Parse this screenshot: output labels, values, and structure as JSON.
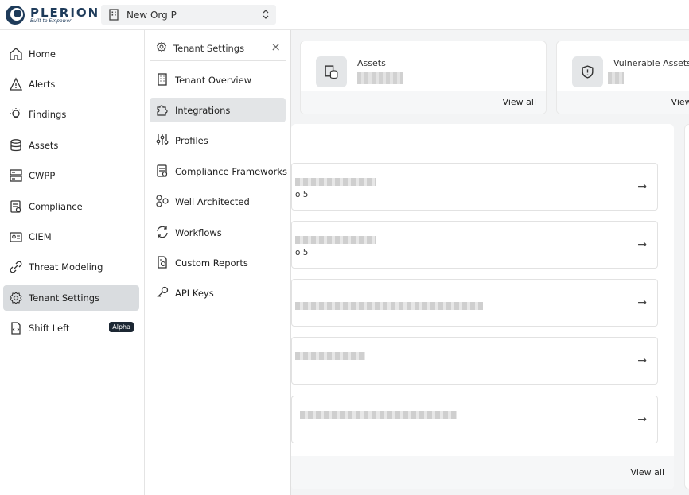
{
  "brand": {
    "name": "PLERION",
    "tagline": "Built to Empower"
  },
  "org_selector": {
    "value": "New Org P"
  },
  "nav": {
    "items": [
      {
        "label": "Home",
        "icon": "home-icon"
      },
      {
        "label": "Alerts",
        "icon": "alert-icon"
      },
      {
        "label": "Findings",
        "icon": "bulb-icon"
      },
      {
        "label": "Assets",
        "icon": "database-icon"
      },
      {
        "label": "CWPP",
        "icon": "server-icon"
      },
      {
        "label": "Compliance",
        "icon": "compliance-icon"
      },
      {
        "label": "CIEM",
        "icon": "id-card-icon"
      },
      {
        "label": "Threat Modeling",
        "icon": "link-icon"
      },
      {
        "label": "Tenant Settings",
        "icon": "gear-icon",
        "active": true
      },
      {
        "label": "Shift Left",
        "icon": "code-file-icon",
        "badge": "Alpha"
      }
    ]
  },
  "panel": {
    "title": "Tenant Settings",
    "items": [
      {
        "label": "Tenant Overview",
        "icon": "building-icon"
      },
      {
        "label": "Integrations",
        "icon": "puzzle-icon",
        "active": true
      },
      {
        "label": "Profiles",
        "icon": "sliders-icon"
      },
      {
        "label": "Compliance Frameworks",
        "icon": "compliance-icon"
      },
      {
        "label": "Well Architected",
        "icon": "hexagons-icon"
      },
      {
        "label": "Workflows",
        "icon": "refresh-icon"
      },
      {
        "label": "Custom Reports",
        "icon": "report-icon"
      },
      {
        "label": "API Keys",
        "icon": "key-icon"
      }
    ]
  },
  "stats": [
    {
      "title": "Assets",
      "footer": "View all"
    },
    {
      "title": "Vulnerable Assets",
      "footer": "View all"
    }
  ],
  "list": {
    "rows": [
      {
        "sub": "o 5"
      },
      {
        "sub": "o 5"
      },
      {
        "sub": ""
      },
      {
        "sub": ""
      },
      {
        "sub": ""
      }
    ],
    "footer": "View all"
  }
}
